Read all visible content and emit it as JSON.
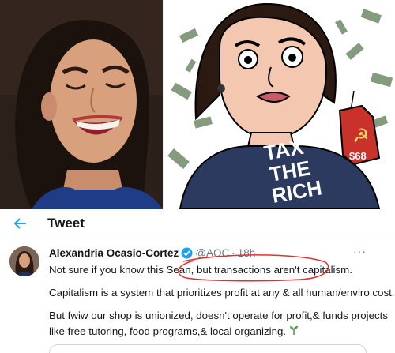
{
  "header": {
    "title": "Tweet"
  },
  "tweet": {
    "display_name": "Alexandria Ocasio-Cortez",
    "handle": "@AOC",
    "separator": "·",
    "time": "18h",
    "more": "···",
    "line1a": "Not sure if you know this Sean, ",
    "line1b": "but transactions aren't capitalism.",
    "line2": "Capitalism is a system that prioritizes profit at any & all human/enviro cost.",
    "line3": "But fwiw our shop is unionized, doesn't operate for profit,& funds projects",
    "line4": "like free tutoring, food programs,& local organizing."
  },
  "cartoon": {
    "shirt_text": [
      "TAX",
      "THE",
      "RICH"
    ],
    "price_tag": "$68",
    "hammer_sickle": "☭"
  },
  "colors": {
    "accent": "#1da1f2",
    "annotation": "#e03030",
    "shirt": "#2b3a5e",
    "tag": "#c8322a"
  },
  "icons": {
    "back": "arrow-left-icon",
    "verified": "verified-badge-icon",
    "more": "more-dots-icon",
    "sprout": "seedling-icon"
  }
}
